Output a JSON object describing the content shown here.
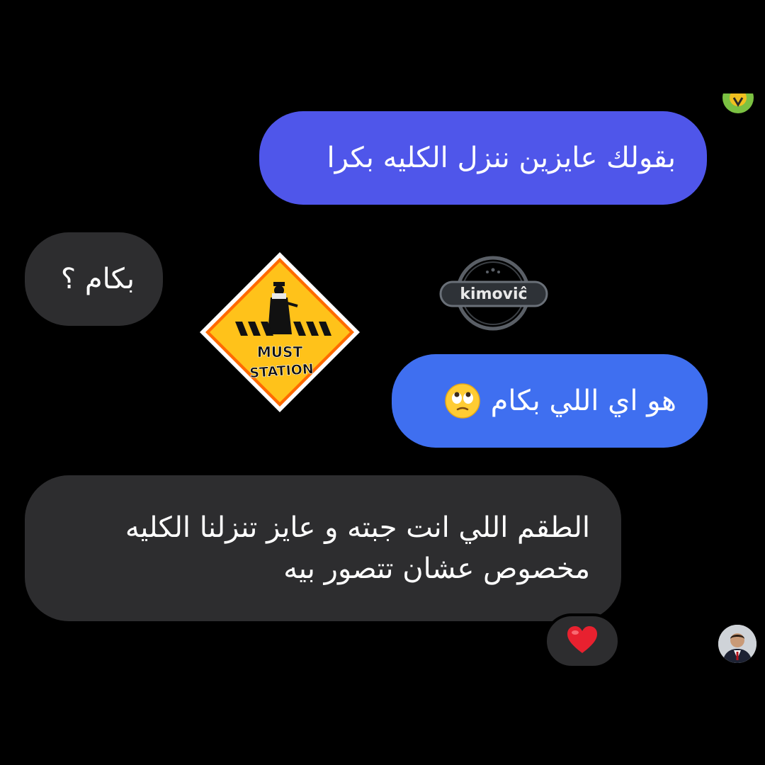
{
  "conversation": {
    "messages": [
      {
        "side": "sent",
        "text": "بقولك عايزين ننزل الكليه بكرا"
      },
      {
        "side": "received",
        "text": "بكام ؟"
      },
      {
        "side": "sent",
        "text": "هو اي اللي بكام"
      },
      {
        "side": "received",
        "lines": [
          "الطقم اللي انت جبته و عايز تنزلنا الكليه",
          "مخصوص عشان تتصور بيه"
        ]
      }
    ],
    "reaction": {
      "icon": "red-heart-icon"
    },
    "emoji": {
      "icon": "face-with-rolling-eyes-icon"
    }
  },
  "watermarks": {
    "sign_line1": "MUST",
    "sign_line2": "STATION",
    "badge_text": "kimoviĉ"
  },
  "colors": {
    "background": "#000000",
    "sent_bubble": "#4f56ea",
    "sent_bubble_2": "#3f6ff0",
    "received_bubble": "#2d2d2f",
    "text": "#ffffff",
    "heart": "#e8212f",
    "sign_yellow": "#ffc21a"
  }
}
